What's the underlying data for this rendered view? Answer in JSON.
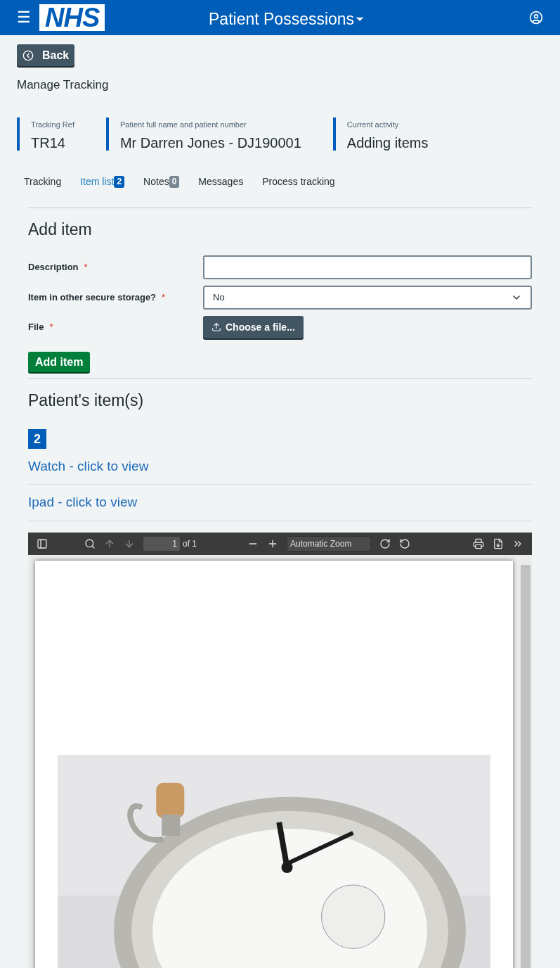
{
  "header": {
    "logo": "NHS",
    "title": "Patient Possessions",
    "menu_icon": "☰"
  },
  "back_button": "Back",
  "page_title": "Manage Tracking",
  "summary": [
    {
      "label": "Tracking Ref",
      "value": "TR14"
    },
    {
      "label": "Patient full name and patient number",
      "value": "Mr Darren Jones - DJ190001"
    },
    {
      "label": "Current activity",
      "value": "Adding items"
    }
  ],
  "tabs": [
    {
      "label": "Tracking",
      "selected": false
    },
    {
      "label": "Item list",
      "badge": "2",
      "selected": true
    },
    {
      "label": "Notes",
      "badge": "0",
      "selected": false
    },
    {
      "label": "Messages",
      "selected": false
    },
    {
      "label": "Process tracking",
      "selected": false
    }
  ],
  "add_item": {
    "heading": "Add item",
    "fields": [
      {
        "kind": "text",
        "label": "Description",
        "required_mark": "*"
      },
      {
        "kind": "select",
        "label": "Item in other secure storage?",
        "required_mark": "*",
        "value": "No"
      },
      {
        "kind": "file",
        "label": "File",
        "required_mark": "*",
        "button": "Choose a file..."
      }
    ],
    "submit": "Add item"
  },
  "items": {
    "heading": "Patient's item(s)",
    "count": "2",
    "links": [
      "Watch - click to view",
      "Ipad - click to view"
    ]
  },
  "pdf_viewer": {
    "page_number": "1",
    "page_total": "of 1",
    "zoom": "Automatic Zoom"
  }
}
